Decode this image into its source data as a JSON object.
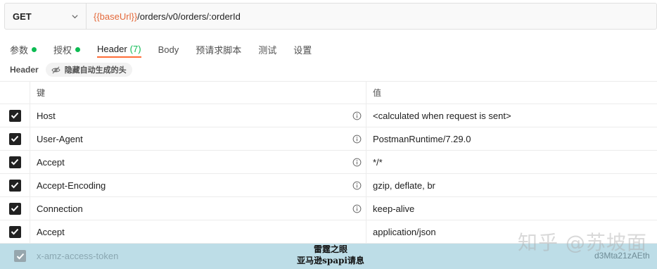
{
  "request": {
    "method": "GET",
    "url_variable": "{{baseUrl}}",
    "url_path": "/orders/v0/orders/:orderId"
  },
  "tabs": [
    {
      "label": "参数",
      "dot": true
    },
    {
      "label": "授权",
      "dot": true
    },
    {
      "label": "Header",
      "count": "(7)",
      "active": true
    },
    {
      "label": "Body"
    },
    {
      "label": "预请求脚本"
    },
    {
      "label": "测试"
    },
    {
      "label": "设置"
    }
  ],
  "headers_section": {
    "title": "Header",
    "hide_button_label": "隐藏自动生成的头"
  },
  "table": {
    "key_header": "键",
    "value_header": "值",
    "rows": [
      {
        "key": "Host",
        "value": "<calculated when request is sent>",
        "checked": true,
        "info": true
      },
      {
        "key": "User-Agent",
        "value": "PostmanRuntime/7.29.0",
        "checked": true,
        "info": true
      },
      {
        "key": "Accept",
        "value": "*/*",
        "checked": true,
        "info": true
      },
      {
        "key": "Accept-Encoding",
        "value": "gzip, deflate, br",
        "checked": true,
        "info": true
      },
      {
        "key": "Connection",
        "value": "keep-alive",
        "checked": true,
        "info": true
      },
      {
        "key": "Accept",
        "value": "application/json",
        "checked": true,
        "info": false
      }
    ],
    "partial_row": {
      "key": "x-amz-access-token",
      "value": "d3Mta21zAEth"
    }
  },
  "banner": {
    "line1": "雷霆之眼",
    "line2": "亚马逊spapi请息"
  },
  "watermark": "知乎 @苏坡面",
  "colors": {
    "accent": "#ff6c37",
    "dot_green": "#0cbb52",
    "url_variable": "#e4693a"
  }
}
